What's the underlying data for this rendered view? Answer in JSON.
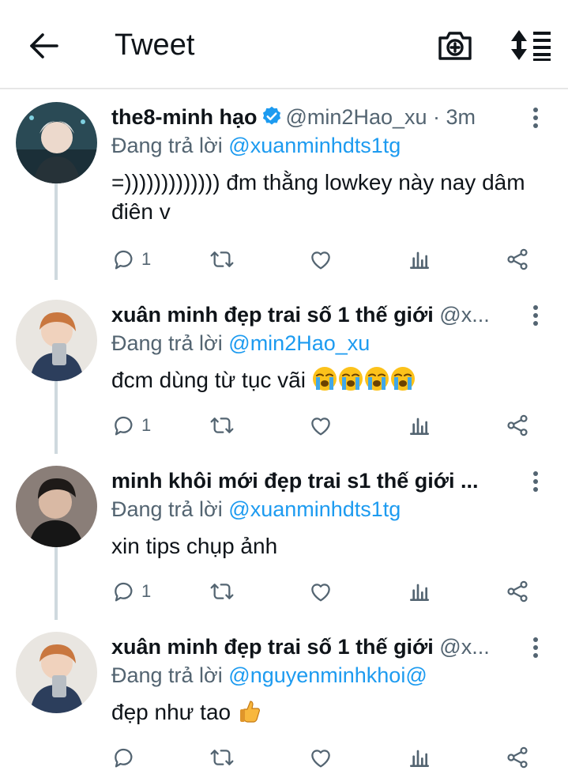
{
  "header": {
    "title": "Tweet",
    "back_icon": "arrow-left-icon",
    "camera_icon": "camera-plus-icon",
    "sort_icon": "sort-list-icon"
  },
  "colors": {
    "link": "#1d9bf0",
    "secondary_text": "#536471",
    "primary_text": "#0f1419",
    "thread_line": "#cfd9de"
  },
  "tweets": [
    {
      "name": "the8-minh hạo",
      "verified": true,
      "handle_time": "@min2Hao_xu · 3m",
      "reply_prefix": "Đang trả lời",
      "reply_to": "@xuanminhdts1tg",
      "body": "=))))))))))))) đm thằng lowkey này nay dâm điên v",
      "reply_count": "1"
    },
    {
      "name": "xuân minh đẹp trai số 1 thế giới",
      "handle_time": "@x...",
      "reply_prefix": "Đang trả lời",
      "reply_to": "@min2Hao_xu",
      "body": "đcm dùng từ tục vãi",
      "body_emoji": "loudly-crying-face ×4",
      "reply_count": "1"
    },
    {
      "name": "minh khôi mới đẹp trai s1 thế giới ...",
      "handle_time": "",
      "reply_prefix": "Đang trả lời",
      "reply_to": "@xuanminhdts1tg",
      "body": "xin tips chụp ảnh",
      "reply_count": "1"
    },
    {
      "name": "xuân minh đẹp trai số 1 thế giới",
      "handle_time": "@x...",
      "reply_prefix": "Đang trả lời",
      "reply_to": "@nguyenminhkhoi@",
      "body": "đẹp như tao",
      "body_emoji": "thumbs-up",
      "reply_count": ""
    }
  ]
}
